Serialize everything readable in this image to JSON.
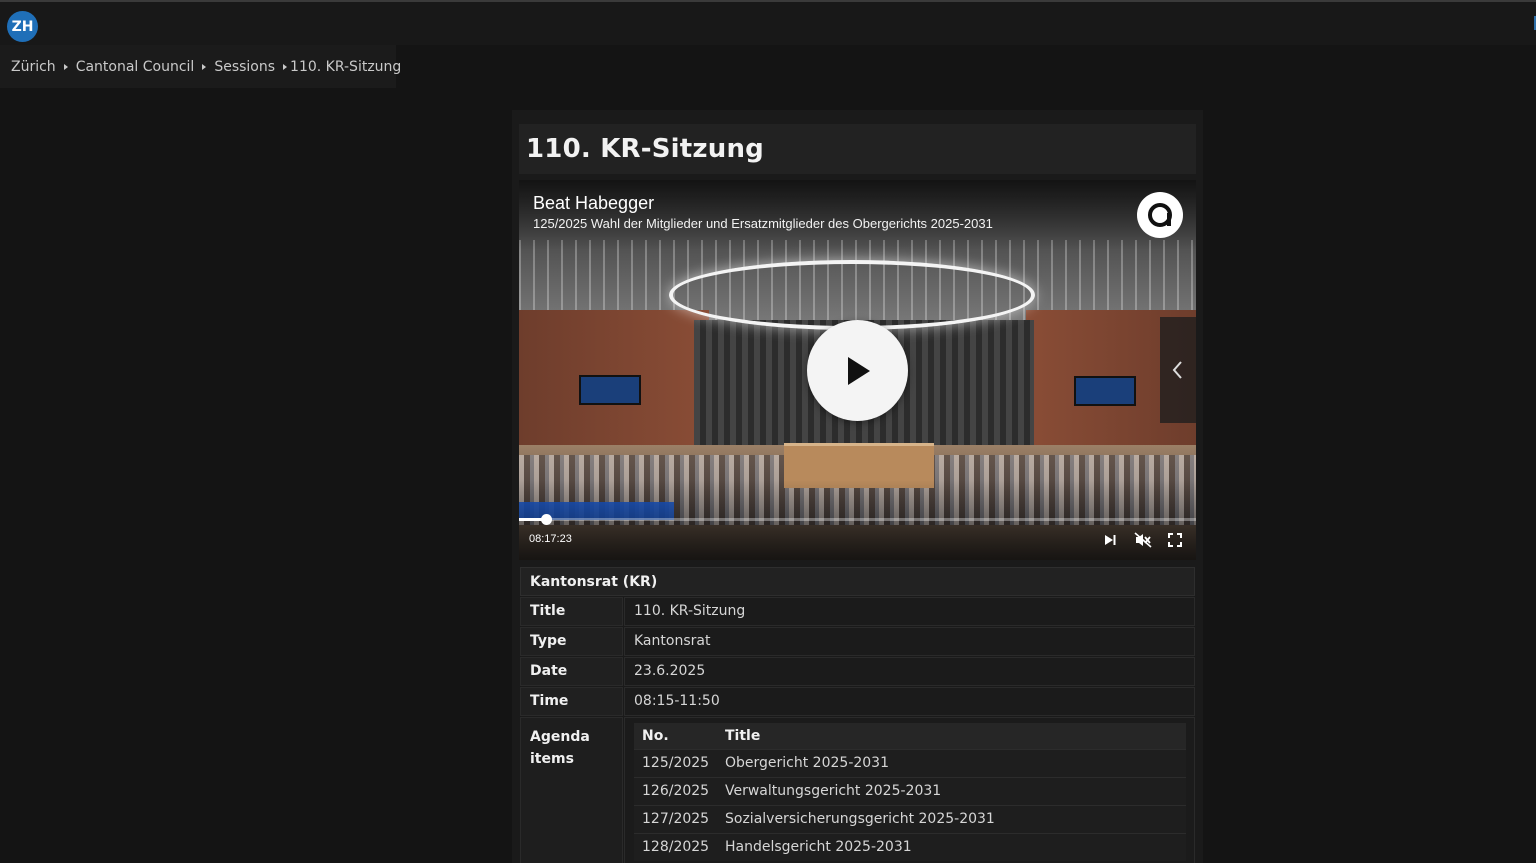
{
  "app": {
    "logo_text": "ZH"
  },
  "breadcrumb": {
    "items": [
      {
        "label": "Zürich"
      },
      {
        "label": "Cantonal Council"
      },
      {
        "label": "Sessions"
      },
      {
        "label": "110. KR-Sitzung"
      }
    ]
  },
  "page": {
    "title": "110. KR-Sitzung"
  },
  "video": {
    "speaker": "Beat Habegger",
    "subtitle": "125/2025 Wahl der Mitglieder und Ersatzmitglieder des Obergerichts 2025-2031",
    "timecode": "08:17:23",
    "progress_fraction": 0.04,
    "brand_icon": "a-logo-icon",
    "controls": [
      "play-icon",
      "skip-next-icon",
      "mute-icon",
      "fullscreen-icon",
      "chevron-left-icon"
    ]
  },
  "info": {
    "header": "Kantonsrat (KR)",
    "rows": [
      {
        "label": "Title",
        "value": "110. KR-Sitzung"
      },
      {
        "label": "Type",
        "value": "Kantonsrat"
      },
      {
        "label": "Date",
        "value": "23.6.2025"
      },
      {
        "label": "Time",
        "value": "08:15-11:50"
      }
    ],
    "agenda_label": "Agenda items",
    "agenda_columns": {
      "no": "No.",
      "title": "Title"
    },
    "agenda": [
      {
        "no": "125/2025",
        "title": "Obergericht 2025-2031"
      },
      {
        "no": "126/2025",
        "title": "Verwaltungsgericht 2025-2031"
      },
      {
        "no": "127/2025",
        "title": "Sozialversicherungsgericht 2025-2031"
      },
      {
        "no": "128/2025",
        "title": "Handelsgericht 2025-2031"
      }
    ]
  },
  "colors": {
    "background": "#141414",
    "logo_blue": "#1f6fb8",
    "overlay_blue": "#1b58c8"
  }
}
